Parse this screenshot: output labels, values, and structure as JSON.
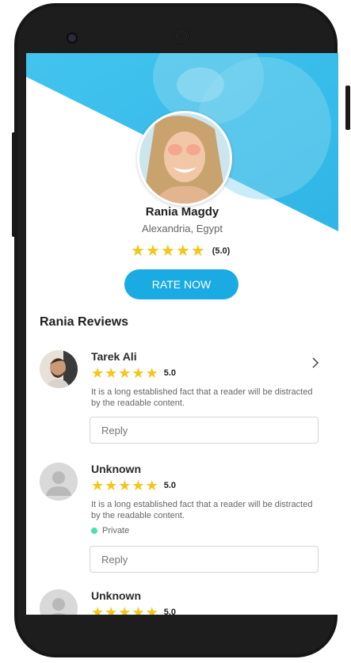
{
  "profile": {
    "name": "Rania Magdy",
    "location": "Alexandria, Egypt",
    "stars": 5,
    "rating_text": "(5.0)",
    "rate_button": "RATE NOW"
  },
  "reviews_section": {
    "title": "Rania Reviews"
  },
  "reviews": [
    {
      "name": "Tarek Ali",
      "stars": 5,
      "score": "5.0",
      "text": "It is a long established fact that a reader will be distracted by the readable content.",
      "reply_placeholder": "Reply"
    },
    {
      "name": "Unknown",
      "stars": 5,
      "score": "5.0",
      "text": "It is a long established fact that a reader will be distracted by the readable content.",
      "private_label": "Private",
      "reply_placeholder": "Reply"
    },
    {
      "name": "Unknown",
      "stars": 5,
      "score": "5.0"
    }
  ],
  "colors": {
    "accent": "#1aabe3",
    "star": "#f5c518",
    "private_dot": "#4be0a7"
  },
  "icons": [
    "camera-icon",
    "speaker-icon",
    "star-icon",
    "chevron-right-icon",
    "user-placeholder-icon"
  ]
}
